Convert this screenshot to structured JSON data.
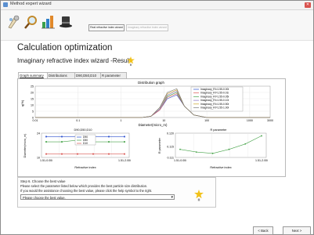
{
  "window": {
    "title": "Method expert wizard",
    "close_glyph": "✕"
  },
  "toolbar": {
    "icons": [
      "wizard-tools-icon",
      "search-magnifier-icon",
      "bar-chart-icon",
      "top-hat-icon"
    ],
    "real_wizard_button": "Real refractive index wizard",
    "imag_wizard_button": "Imaginary refractive index wizard"
  },
  "header": {
    "title": "Calculation optimization",
    "subtitle": "Imaginary refractive index wizard -Result-"
  },
  "tabs": [
    {
      "label": "Graph summary",
      "active": true
    },
    {
      "label": "Distributions",
      "active": false
    },
    {
      "label": "D90,D50,D10",
      "active": false
    },
    {
      "label": "R parameter",
      "active": false
    }
  ],
  "charts": {
    "distribution": {
      "title": "Distribution graph",
      "ylabel": "q(%)",
      "xlabel": "Diameter(micro_m)",
      "yticks": [
        "25",
        "20",
        "15",
        "10",
        "5",
        "0"
      ],
      "xticks": [
        "0.01",
        "0.1",
        "1",
        "10",
        "100",
        "1000",
        "3000"
      ],
      "legend": [
        "Imaginary_RI=1.55-0.00i",
        "Imaginary_RI=1.55-0.01i",
        "Imaginary_RI=1.55-0.05i",
        "Imaginary_RI=1.55-0.10i",
        "Imaginary_RI=1.55-0.50i",
        "Imaginary_RI=1.55-1.00i"
      ],
      "colors": [
        "#2b4fcf",
        "#d9534f",
        "#46a349",
        "#8a6fc4",
        "#c9a227",
        "#777777"
      ]
    },
    "d_values": {
      "title": "D90,D50,D10",
      "ylabel": "Diameter(micro_m)",
      "xlabel": "Refractive index",
      "yticks": [
        "24",
        "10"
      ],
      "xticks": [
        "1.51-0.00i",
        "1.51-2.00i"
      ],
      "legend": [
        "D90",
        "D50",
        "D10"
      ]
    },
    "r_param": {
      "title": "R parameter",
      "ylabel": "R parameter",
      "xlabel": "Refractive index",
      "yticks": [
        "0.120",
        "0.115",
        "0.111"
      ],
      "xticks": [
        "1.51-0.00i",
        "1.51-2.00i"
      ]
    }
  },
  "step": {
    "title": "Step 6. Choose the best value",
    "line1": "Please select the parameter listed below which provides the best particle size distribution.",
    "line2": "If you would the assistance choosing the best value, please click the help symbol to the right.",
    "select_value": "Please choose the best value."
  },
  "nav": {
    "back": "< Back",
    "next": "Next >"
  },
  "chart_data": [
    {
      "type": "line",
      "title": "Distribution graph",
      "xlabel": "Diameter(micro_m)",
      "ylabel": "q(%)",
      "x": [
        0.01,
        0.1,
        1,
        3,
        5,
        8,
        12,
        20,
        30,
        50,
        100,
        1000,
        3000
      ],
      "series": [
        {
          "name": "Imaginary_RI=1.55-0.00i",
          "values": [
            0,
            0,
            0,
            0,
            1,
            6,
            15,
            18,
            9,
            2,
            0,
            0,
            0
          ]
        },
        {
          "name": "Imaginary_RI=1.55-0.01i",
          "values": [
            0,
            0,
            0,
            0,
            1,
            6,
            16,
            19,
            9,
            2,
            0,
            0,
            0
          ]
        },
        {
          "name": "Imaginary_RI=1.55-0.05i",
          "values": [
            0,
            0,
            0,
            0,
            1,
            7,
            17,
            20,
            9,
            2,
            0,
            0,
            0
          ]
        },
        {
          "name": "Imaginary_RI=1.55-0.10i",
          "values": [
            0,
            0,
            0,
            0,
            1,
            7,
            18,
            21,
            9,
            2,
            0,
            0,
            0
          ]
        },
        {
          "name": "Imaginary_RI=1.55-0.50i",
          "values": [
            0,
            0,
            0,
            0,
            1,
            8,
            19,
            22,
            9,
            2,
            0,
            0,
            0
          ]
        },
        {
          "name": "Imaginary_RI=1.55-1.00i",
          "values": [
            0,
            0,
            0,
            0,
            1,
            8,
            20,
            23,
            9,
            2,
            0,
            0,
            0
          ]
        }
      ],
      "ylim": [
        0,
        25
      ],
      "xscale": "log"
    },
    {
      "type": "line",
      "title": "D90,D50,D10",
      "xlabel": "Refractive index",
      "ylabel": "Diameter(micro_m)",
      "categories": [
        "1.51-0.00i",
        "",
        "",
        "",
        "",
        "1.51-2.00i"
      ],
      "series": [
        {
          "name": "D90",
          "values": [
            22,
            22,
            22,
            22,
            22,
            22
          ]
        },
        {
          "name": "D50",
          "values": [
            19,
            19,
            20,
            19,
            19,
            19
          ]
        },
        {
          "name": "D10",
          "values": [
            12,
            12,
            12,
            12,
            12,
            12
          ]
        }
      ],
      "ylim": [
        10,
        24
      ]
    },
    {
      "type": "line",
      "title": "R parameter",
      "xlabel": "Refractive index",
      "ylabel": "R parameter",
      "categories": [
        "1.51-0.00i",
        "",
        "",
        "",
        "",
        "1.51-2.00i"
      ],
      "series": [
        {
          "values": [
            0.114,
            0.113,
            0.1125,
            0.114,
            0.116,
            0.119
          ]
        }
      ],
      "ylim": [
        0.111,
        0.12
      ]
    }
  ]
}
